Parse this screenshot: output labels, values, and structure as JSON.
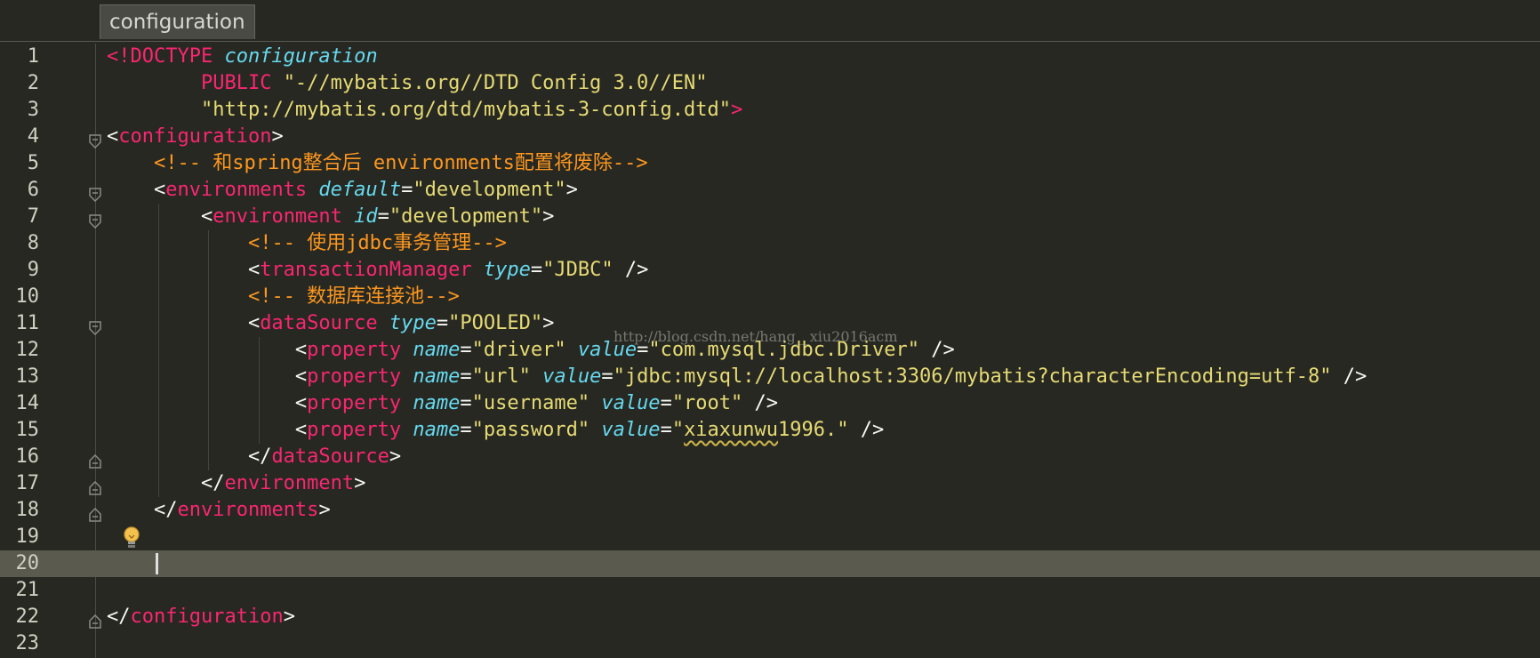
{
  "breadcrumb": {
    "item": "configuration"
  },
  "watermark": "http://blog.csdn.net/hang__xiu2016acm",
  "editor": {
    "current_line": 20,
    "lines": [
      {
        "n": "1",
        "segs": [
          [
            "pink",
            "<!DOCTYPE "
          ],
          [
            "cyan",
            "configuration"
          ]
        ]
      },
      {
        "n": "2",
        "segs": [
          [
            "pl",
            "        "
          ],
          [
            "pink",
            "PUBLIC "
          ],
          [
            "str",
            "\"-//mybatis.org//DTD Config 3.0//EN\""
          ]
        ]
      },
      {
        "n": "3",
        "segs": [
          [
            "pl",
            "        "
          ],
          [
            "str",
            "\"http://mybatis.org/dtd/mybatis-3-config.dtd\""
          ],
          [
            "pink",
            ">"
          ]
        ]
      },
      {
        "n": "4",
        "fold": "open",
        "segs": [
          [
            "pl",
            "<"
          ],
          [
            "pink",
            "configuration"
          ],
          [
            "pl",
            ">"
          ]
        ]
      },
      {
        "n": "5",
        "segs": [
          [
            "pl",
            "    "
          ],
          [
            "cmt",
            "<!-- 和spring整合后 environments配置将废除-->"
          ]
        ]
      },
      {
        "n": "6",
        "fold": "open",
        "segs": [
          [
            "pl",
            "    <"
          ],
          [
            "pink",
            "environments "
          ],
          [
            "cyan",
            "default"
          ],
          [
            "pl",
            "="
          ],
          [
            "str",
            "\"development\""
          ],
          [
            "pl",
            ">"
          ]
        ]
      },
      {
        "n": "7",
        "fold": "open",
        "segs": [
          [
            "pl",
            "        <"
          ],
          [
            "pink",
            "environment "
          ],
          [
            "cyan",
            "id"
          ],
          [
            "pl",
            "="
          ],
          [
            "str",
            "\"development\""
          ],
          [
            "pl",
            ">"
          ]
        ]
      },
      {
        "n": "8",
        "segs": [
          [
            "pl",
            "            "
          ],
          [
            "cmt",
            "<!-- 使用jdbc事务管理-->"
          ]
        ]
      },
      {
        "n": "9",
        "segs": [
          [
            "pl",
            "            <"
          ],
          [
            "pink",
            "transactionManager "
          ],
          [
            "cyan",
            "type"
          ],
          [
            "pl",
            "="
          ],
          [
            "str",
            "\"JDBC\""
          ],
          [
            "pl",
            " />"
          ]
        ]
      },
      {
        "n": "10",
        "segs": [
          [
            "pl",
            "            "
          ],
          [
            "cmt",
            "<!-- 数据库连接池-->"
          ]
        ]
      },
      {
        "n": "11",
        "fold": "open",
        "segs": [
          [
            "pl",
            "            <"
          ],
          [
            "pink",
            "dataSource "
          ],
          [
            "cyan",
            "type"
          ],
          [
            "pl",
            "="
          ],
          [
            "str",
            "\"POOLED\""
          ],
          [
            "pl",
            ">"
          ]
        ]
      },
      {
        "n": "12",
        "segs": [
          [
            "pl",
            "                <"
          ],
          [
            "pink",
            "property "
          ],
          [
            "cyan",
            "name"
          ],
          [
            "pl",
            "="
          ],
          [
            "str",
            "\"driver\" "
          ],
          [
            "cyan",
            "value"
          ],
          [
            "pl",
            "="
          ],
          [
            "str",
            "\"com.mysql.jdbc.Driver\""
          ],
          [
            "pl",
            " />"
          ]
        ]
      },
      {
        "n": "13",
        "segs": [
          [
            "pl",
            "                <"
          ],
          [
            "pink",
            "property "
          ],
          [
            "cyan",
            "name"
          ],
          [
            "pl",
            "="
          ],
          [
            "str",
            "\"url\" "
          ],
          [
            "cyan",
            "value"
          ],
          [
            "pl",
            "="
          ],
          [
            "str",
            "\"jdbc:mysql://localhost:3306/mybatis?characterEncoding=utf-8\""
          ],
          [
            "pl",
            " />"
          ]
        ]
      },
      {
        "n": "14",
        "segs": [
          [
            "pl",
            "                <"
          ],
          [
            "pink",
            "property "
          ],
          [
            "cyan",
            "name"
          ],
          [
            "pl",
            "="
          ],
          [
            "str",
            "\"username\" "
          ],
          [
            "cyan",
            "value"
          ],
          [
            "pl",
            "="
          ],
          [
            "str",
            "\"root\""
          ],
          [
            "pl",
            " />"
          ]
        ]
      },
      {
        "n": "15",
        "segs": [
          [
            "pl",
            "                <"
          ],
          [
            "pink",
            "property "
          ],
          [
            "cyan",
            "name"
          ],
          [
            "pl",
            "="
          ],
          [
            "str",
            "\"password\" "
          ],
          [
            "cyan",
            "value"
          ],
          [
            "pl",
            "="
          ],
          [
            "str",
            "\""
          ],
          [
            "str squig",
            "xiaxunwu"
          ],
          [
            "str",
            "1996.\""
          ],
          [
            "pl",
            " />"
          ]
        ]
      },
      {
        "n": "16",
        "fold": "close",
        "segs": [
          [
            "pl",
            "            </"
          ],
          [
            "pink",
            "dataSource"
          ],
          [
            "pl",
            ">"
          ]
        ]
      },
      {
        "n": "17",
        "fold": "close",
        "segs": [
          [
            "pl",
            "        </"
          ],
          [
            "pink",
            "environment"
          ],
          [
            "pl",
            ">"
          ]
        ]
      },
      {
        "n": "18",
        "fold": "close",
        "segs": [
          [
            "pl",
            "    </"
          ],
          [
            "pink",
            "environments"
          ],
          [
            "pl",
            ">"
          ]
        ]
      },
      {
        "n": "19",
        "bulb": true,
        "segs": []
      },
      {
        "n": "20",
        "caret": true,
        "segs": []
      },
      {
        "n": "21",
        "segs": []
      },
      {
        "n": "22",
        "fold": "close",
        "segs": [
          [
            "pl",
            "</"
          ],
          [
            "pink",
            "configuration"
          ],
          [
            "pl",
            ">"
          ]
        ]
      },
      {
        "n": "23",
        "segs": []
      }
    ]
  }
}
